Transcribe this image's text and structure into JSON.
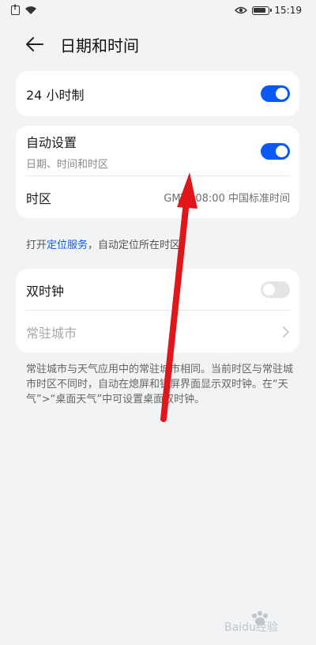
{
  "status": {
    "time": "15:19"
  },
  "header": {
    "title": "日期和时间"
  },
  "card24h": {
    "label": "24 小时制",
    "on": true
  },
  "cardAuto": {
    "label": "自动设置",
    "sub": "日期、时间和时区",
    "on": true,
    "timezone_label": "时区",
    "timezone_value": "GMT+08:00 中国标准时间"
  },
  "hint": {
    "prefix": "打开",
    "link": "定位服务",
    "suffix": "，自动定位所在时区"
  },
  "dualClock": {
    "label": "双时钟",
    "on": false,
    "city_label": "常驻城市"
  },
  "footnote": "常驻城市与天气应用中的常驻城市相同。当前时区与常驻城市时区不同时，自动在熄屏和锁屏界面显示双时钟。在“天气”>“桌面天气”中可设置桌面双时钟。",
  "watermark": {
    "text": "Baidu经验"
  },
  "colors": {
    "accent": "#0a59f7",
    "arrow": "#e0161b",
    "background": "#f1f3f5"
  }
}
